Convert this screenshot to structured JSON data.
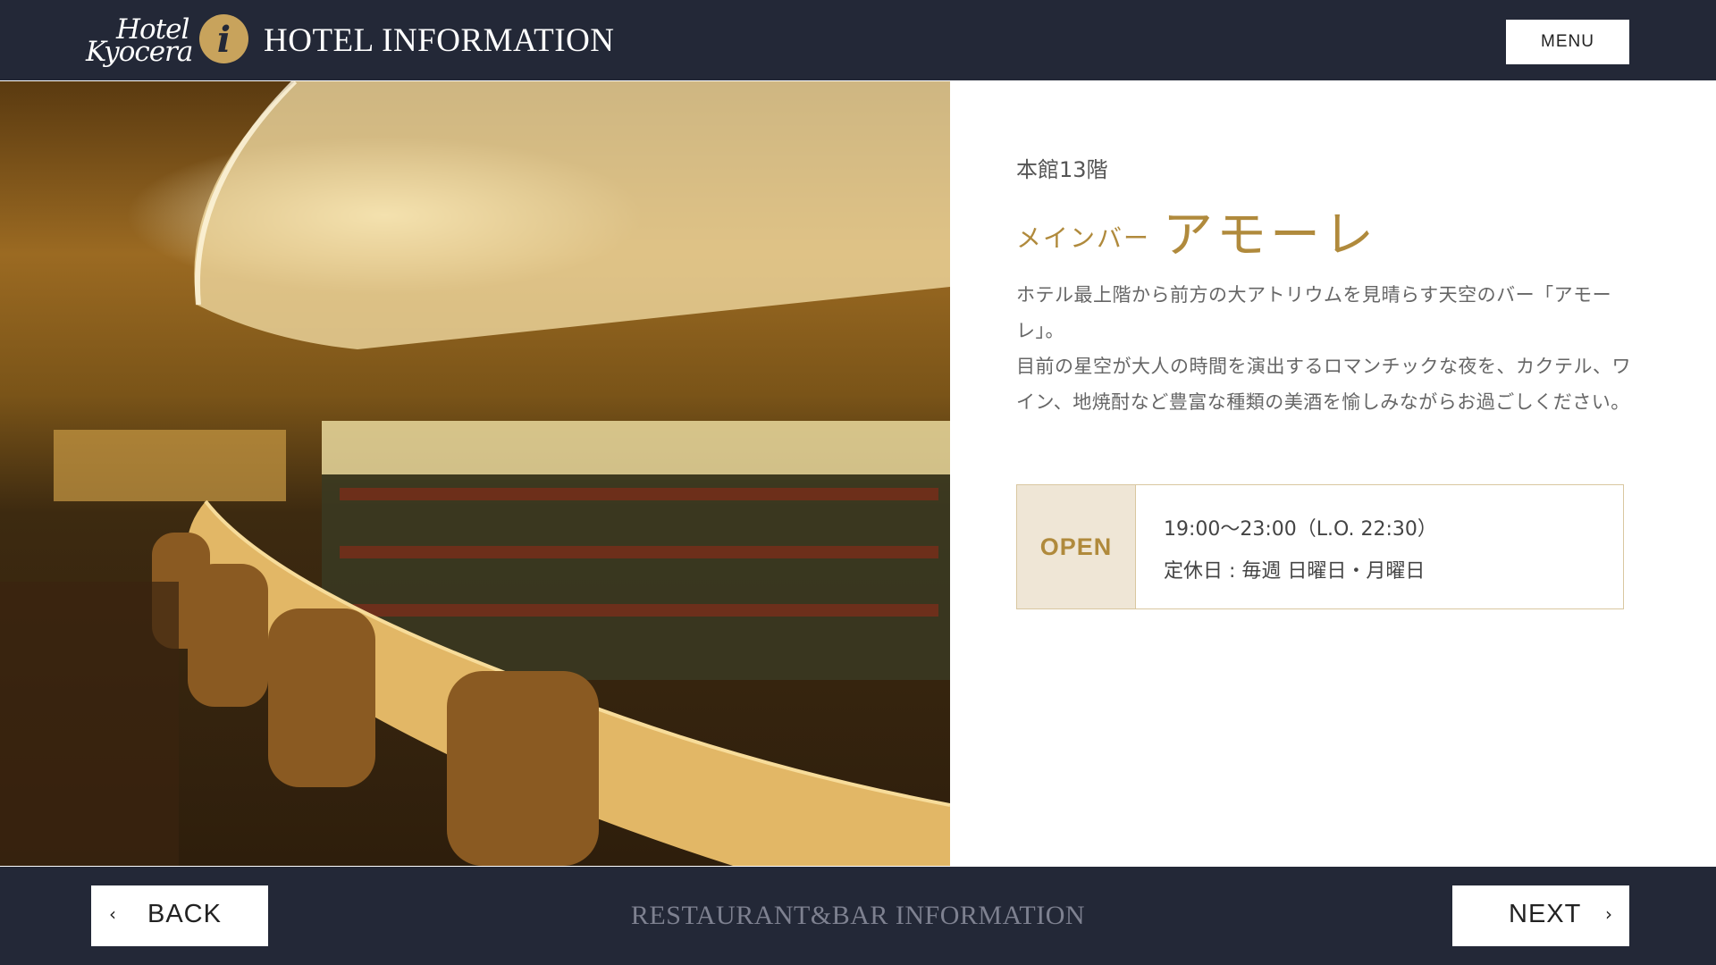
{
  "header": {
    "logo_line1": "Hotel",
    "logo_line2": "Kyocera",
    "info_glyph": "i",
    "title": "HOTEL INFORMATION",
    "menu_label": "MENU"
  },
  "venue": {
    "floor": "本館13階",
    "name_prefix": "メインバー",
    "name": "アモーレ",
    "description": [
      "ホテル最上階から前方の大アトリウムを見晴らす天空のバー「アモーレ」。",
      "目前の星空が大人の時間を演出するロマンチックな夜を、カクテル、ワイン、地焼酎など豊富な種類の美酒を愉しみながらお過ごしください。"
    ],
    "open_label": "OPEN",
    "hours": "19:00〜23:00（L.O. 22:30）",
    "closed": "定休日 : 毎週 日曜日・月曜日"
  },
  "footer": {
    "back_label": "BACK",
    "next_label": "NEXT",
    "section_title": "RESTAURANT&BAR INFORMATION",
    "back_icon": "chevron-left-icon",
    "next_icon": "chevron-right-icon"
  },
  "colors": {
    "navy": "#232837",
    "gold": "#b08a3c",
    "open_bg": "#efe6d6"
  }
}
